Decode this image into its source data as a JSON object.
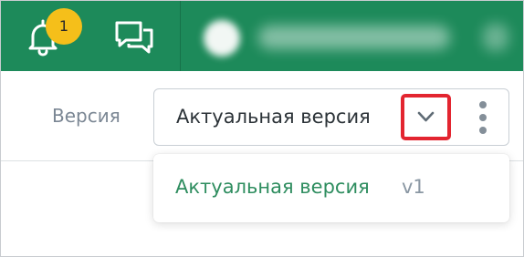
{
  "header": {
    "notifications_count": "1",
    "user_name": "",
    "accent_color": "#1d8a5a",
    "badge_color": "#f5bf1a"
  },
  "version": {
    "label": "Версия",
    "selected": "Актуальная версия",
    "options": [
      {
        "label": "Актуальная версия",
        "tag": "v1"
      }
    ],
    "highlight_color": "#e32530"
  },
  "icons": {
    "bell": "bell-icon",
    "chat": "chat-icon",
    "chevron": "chevron-down-icon",
    "more": "more-vertical-icon"
  }
}
